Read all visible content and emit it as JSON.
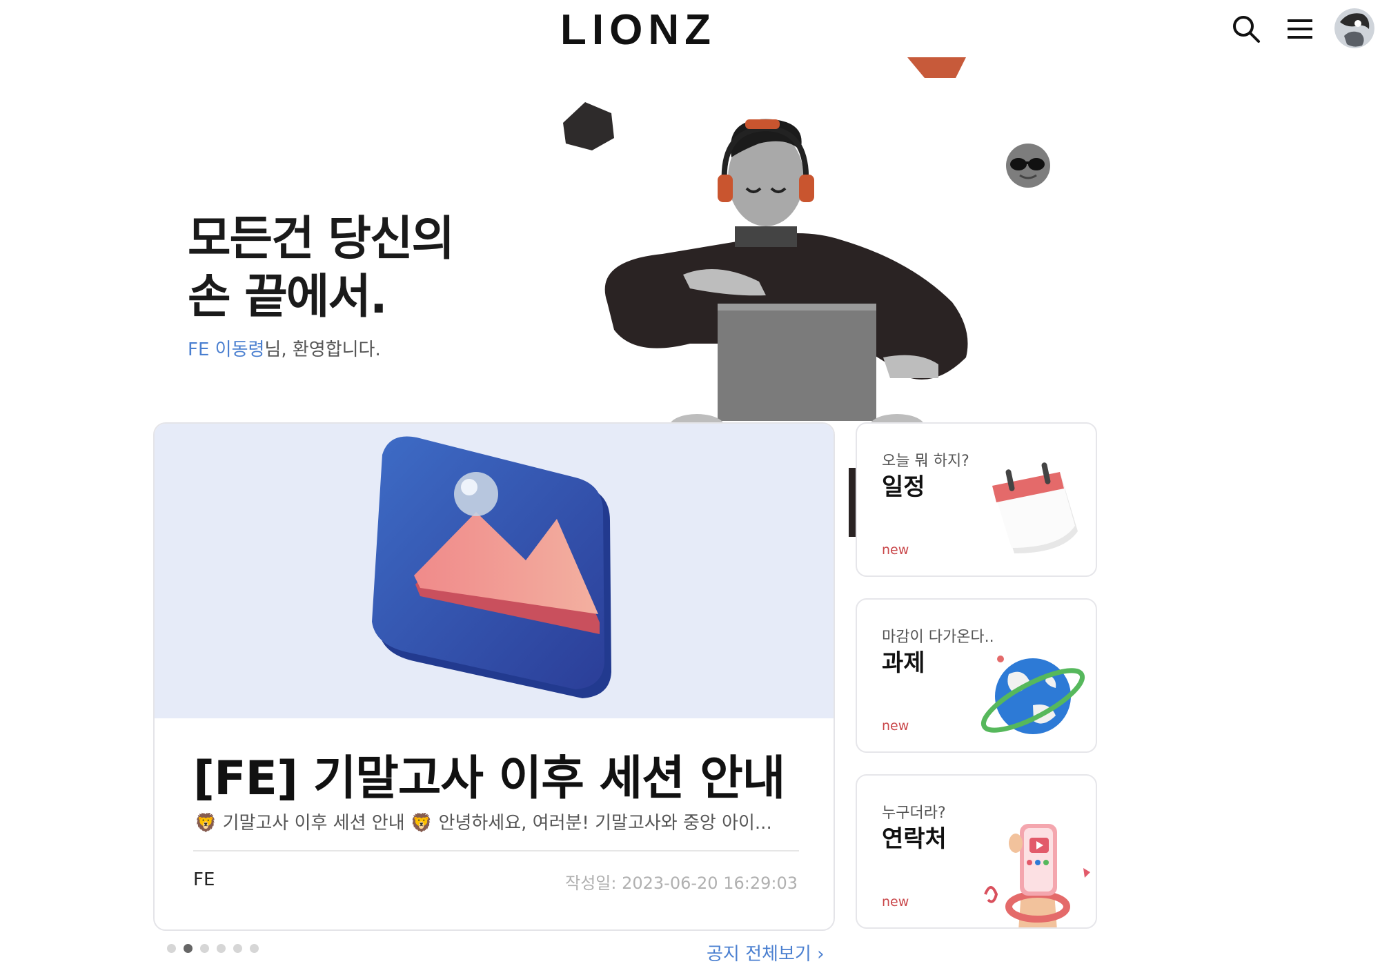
{
  "header": {
    "logo": "LIONZ",
    "search_icon": "search-icon",
    "menu_icon": "hamburger-menu-icon",
    "avatar": "user-avatar"
  },
  "hero": {
    "title_line1": "모든건 당신의",
    "title_line2": "손 끝에서.",
    "welcome_user": "FE 이동령",
    "welcome_rest": "님, 환영합니다."
  },
  "notice": {
    "title": "[FE] 기말고사 이후 세션 안내",
    "preview": "🦁 기말고사 이후 세션 안내 🦁 안녕하세요, 여러분! 기말고사와 중앙 아이...",
    "category": "FE",
    "date": "작성일: 2023-06-20 16:29:03",
    "view_all": "공지 전체보기",
    "pagination": {
      "total": 6,
      "active": 2
    }
  },
  "side_cards": [
    {
      "subtitle": "오늘 뭐 하지?",
      "title": "일정",
      "badge": "new",
      "icon": "calendar-icon"
    },
    {
      "subtitle": "마감이 다가온다..",
      "title": "과제",
      "badge": "new",
      "icon": "globe-icon"
    },
    {
      "subtitle": "누구더라?",
      "title": "연락처",
      "badge": "new",
      "icon": "phone-icon"
    }
  ],
  "colors": {
    "accent_blue": "#4a7fd0",
    "new_red": "#c9474a",
    "notice_bg": "#e6ebf8"
  }
}
